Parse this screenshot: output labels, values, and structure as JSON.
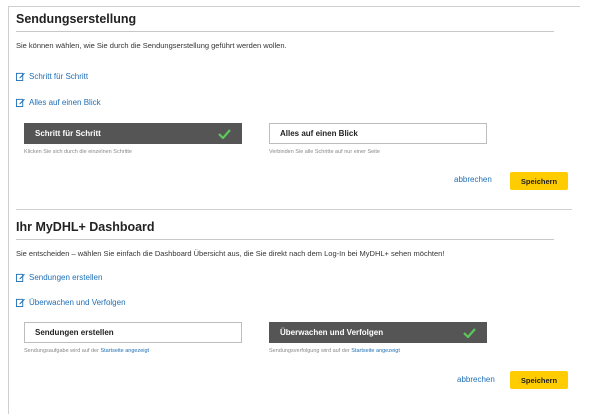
{
  "section1": {
    "title": "Sendungserstellung",
    "description": "Sie können wählen, wie Sie durch die Sendungserstellung geführt werden wollen.",
    "links": [
      {
        "label": "Schritt für Schritt"
      },
      {
        "label": "Alles auf einen Blick"
      }
    ],
    "options": [
      {
        "label": "Schritt für Schritt",
        "selected": true,
        "hint": "Klicken Sie sich durch die einzelnen Schritte"
      },
      {
        "label": "Alles auf einen Blick",
        "selected": false,
        "hint": "Verbinden Sie alle Schritte auf nur einer Seite"
      }
    ],
    "cancel_label": "abbrechen",
    "save_label": "Speichern"
  },
  "section2": {
    "title": "Ihr MyDHL+ Dashboard",
    "description": "Sie entscheiden – wählen Sie einfach die Dashboard Übersicht aus, die Sie direkt nach dem Log-In bei MyDHL+ sehen möchten!",
    "links": [
      {
        "label": "Sendungen erstellen"
      },
      {
        "label": "Überwachen und Verfolgen"
      }
    ],
    "options": [
      {
        "label": "Sendungen erstellen",
        "selected": false,
        "hint_prefix": "Sendungsaufgabe wird auf der ",
        "hint_link": "Startseite angezeigt"
      },
      {
        "label": "Überwachen und Verfolgen",
        "selected": true,
        "hint_prefix": "Sendungsverfolgung wird auf der ",
        "hint_link": "Startseite angezeigt"
      }
    ],
    "cancel_label": "abbrechen",
    "save_label": "Speichern"
  },
  "colors": {
    "accent_yellow": "#ffcc00",
    "link_blue": "#1f6fb5",
    "selected_bg": "#555555",
    "check_green": "#5cc85c"
  },
  "icons": {
    "link_icon": "edit-icon",
    "selected_icon": "checkmark-icon"
  }
}
